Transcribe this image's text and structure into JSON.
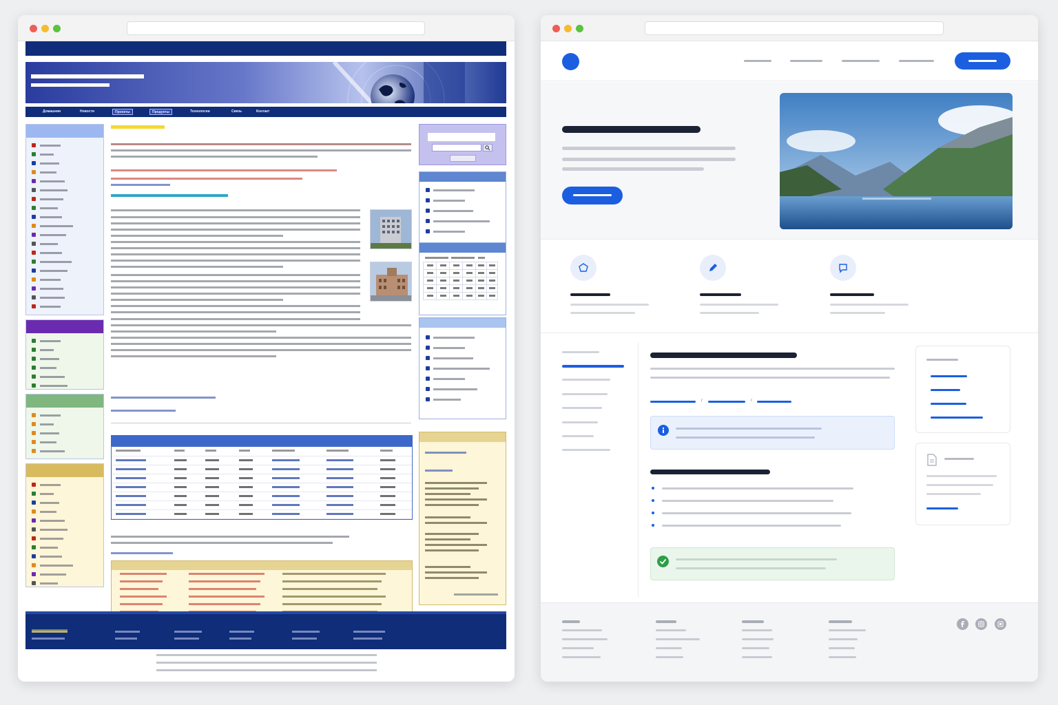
{
  "windows": {
    "left": {
      "description": "legacy portal"
    },
    "right": {
      "description": "modern site"
    }
  },
  "legacy": {
    "nav_items": [
      "Домашняя",
      "Новости",
      "Проекты",
      "Продукты",
      "Технологии",
      "Связь",
      "Контакт"
    ],
    "sidebar_sections": [
      {
        "color": "#9db8f0",
        "text_color": "#1d3da0",
        "count": 19
      },
      {
        "color": "#6a2bb0",
        "count": 6
      },
      {
        "color": "#7fb77f",
        "count": 5
      },
      {
        "color": "#d9bb5f",
        "count": 12
      }
    ],
    "table_rows": 7
  },
  "colors": {
    "legacy_navy": "#0f2d78",
    "legacy_blue": "#3d68c9",
    "modern_accent": "#1b5fe0",
    "success": "#2e9e47"
  },
  "icons": [
    "globe-icon",
    "search-icon",
    "info-icon",
    "check-icon",
    "document-icon",
    "facebook-icon",
    "instagram-icon",
    "share-icon"
  ]
}
